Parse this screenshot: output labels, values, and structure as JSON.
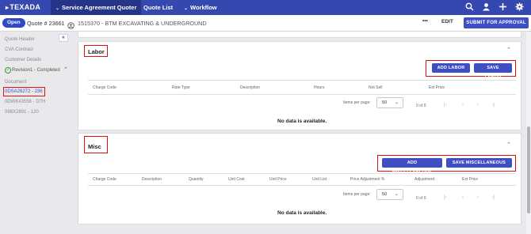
{
  "topbar": {
    "logo": "TEXADA",
    "nav": [
      "Service Agreement Quoter",
      "Quote List",
      "Workflow"
    ],
    "icons": [
      "search-icon",
      "user-icon",
      "plus-icon",
      "gear-icon"
    ]
  },
  "subbar": {
    "status": "Open",
    "quote": "Quote # 23661",
    "customer": "1515370 - BTM EXCAVATING & UNDERGROUND",
    "more": "•••",
    "edit": "EDIT",
    "approve": "SUBMIT FOR APPROVAL"
  },
  "sidebar": {
    "items": [
      "Quote Header",
      "CVA Contract",
      "Customer Details"
    ],
    "revision": "Revision1 - Completed",
    "document": "Document",
    "equipment": [
      "0DSA26272 - 236",
      "0DWK43556 - D7H",
      "098X2891 - 120"
    ]
  },
  "labor": {
    "title": "Labor",
    "add_button": "ADD LABOR",
    "save_button": "SAVE LABOR",
    "columns": [
      "Charge Code",
      "Rate Type",
      "Description",
      "Hours",
      "Not Sell",
      "Ext Price"
    ],
    "items_per_page_label": "Items per page:",
    "items_per_page": "50",
    "range": "0 of 0",
    "empty": "No data is available."
  },
  "misc": {
    "title": "Misc",
    "add_button": "ADD MISCELLANEOUS",
    "save_button": "SAVE MISCELLANEOUS",
    "columns": [
      "Charge Code",
      "Description",
      "Quantity",
      "Unit Cost",
      "Unit Price",
      "Unit List",
      "Price Adjustment %",
      "Adjustment",
      "Ext Price"
    ],
    "items_per_page_label": "Items per page:",
    "items_per_page": "50",
    "range": "0 of 0",
    "empty": "No data is available."
  },
  "colors": {
    "brand": "#3548b0",
    "accent": "#3d4fc3",
    "highlight": "#e01010"
  }
}
